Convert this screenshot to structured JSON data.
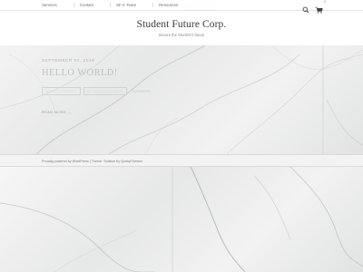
{
  "nav": {
    "items": [
      {
        "label": "Services"
      },
      {
        "label": "Contact"
      },
      {
        "label": "SF-C Team"
      },
      {
        "label": "Resources"
      }
    ],
    "cart_count": "0",
    "icons": [
      "search-icon",
      "cart-icon"
    ]
  },
  "header": {
    "title": "Student Future Corp.",
    "tagline": "Secure the Student's future"
  },
  "post": {
    "date": "SEPTEMBER 03, 2019",
    "title": "HELLO WORLD!",
    "tags": [
      "UNCATEGORIZED",
      "BY KASMEHSANDLE",
      "COMMENT"
    ],
    "read_more": "READ MORE →"
  },
  "footer": {
    "text": "Proudly powered by WordPress | Theme: Solstice by QuirkyThemes"
  },
  "colors": {
    "background": "#e9ebea",
    "nav_text": "#6b6b6b",
    "title_text": "#3b3b3b"
  }
}
